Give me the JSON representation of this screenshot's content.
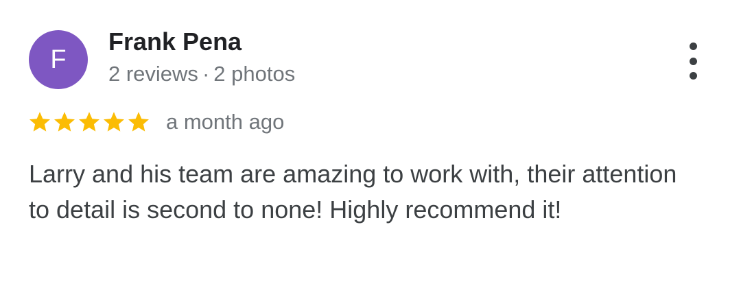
{
  "review": {
    "avatar_letter": "F",
    "avatar_color": "#7e57c2",
    "author_name": "Frank Pena",
    "reviews_count": "2 reviews",
    "separator": "·",
    "photos_count": "2 photos",
    "rating": 5,
    "rating_max": 5,
    "star_color": "#fbbc04",
    "time": "a month ago",
    "text": "Larry and his team are amazing to work with, their attention to detail is second to none! Highly recommend it!",
    "more_icon": "more-vert-icon"
  }
}
